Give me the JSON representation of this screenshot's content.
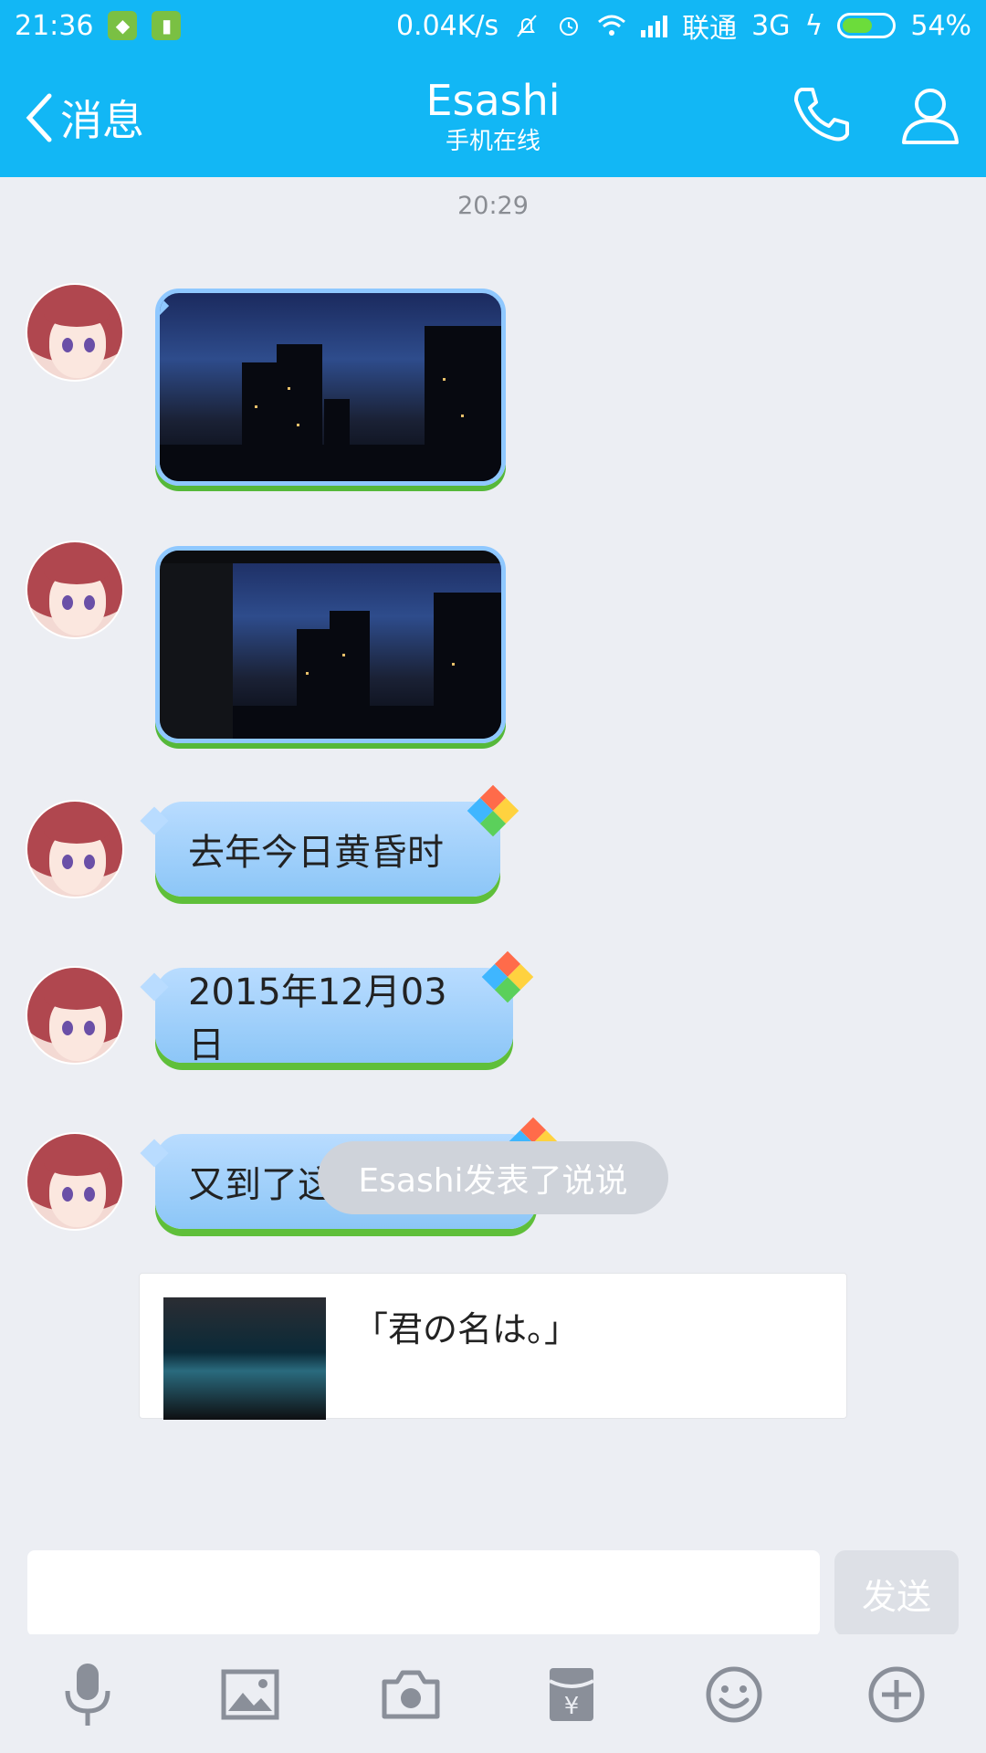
{
  "status_bar": {
    "time": "21:36",
    "net_speed": "0.04K/s",
    "carrier": "联通",
    "network": "3G",
    "battery": "54%",
    "battery_level": 0.54
  },
  "header": {
    "back_label": "消息",
    "title": "Esashi",
    "subtitle": "手机在线"
  },
  "chat": {
    "timestamp": "20:29",
    "text_messages": [
      {
        "text": "去年今日黄昏时"
      },
      {
        "text": "2015年12月03日"
      },
      {
        "text": "又到了这个时节啊"
      }
    ],
    "notice": "Esashi发表了说说",
    "card": {
      "text": "「君の名は。」"
    }
  },
  "input": {
    "value": "",
    "send_label": "发送"
  },
  "toolbar": {
    "items": [
      "mic-icon",
      "image-icon",
      "camera-icon",
      "red-packet-icon",
      "emoji-icon",
      "plus-icon"
    ]
  },
  "colors": {
    "brand": "#12b7f5",
    "background": "#eceef3",
    "bubble_blue": "#8cc6f7",
    "grass_green": "#5fbf3a"
  }
}
